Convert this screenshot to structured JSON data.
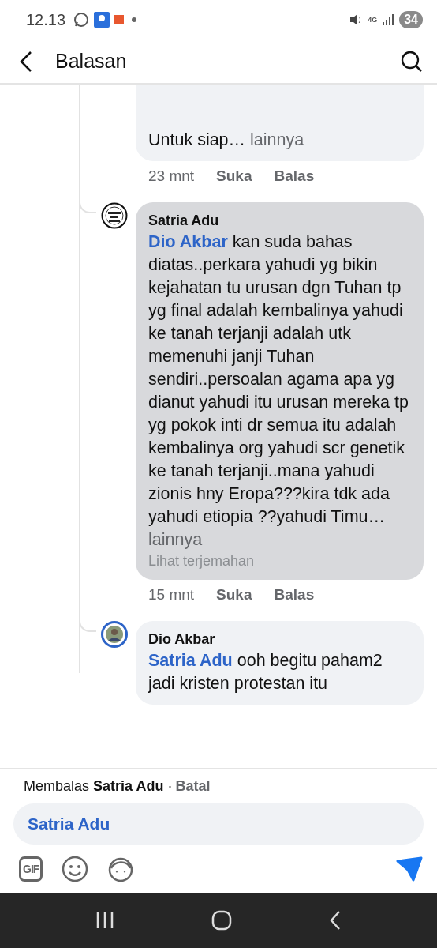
{
  "status_bar": {
    "time": "12.13",
    "network": "4G",
    "battery": "34"
  },
  "header": {
    "title": "Balasan"
  },
  "comments": [
    {
      "text": "Untuk siap…",
      "more": "lainnya",
      "time": "23 mnt",
      "actions": [
        "Suka",
        "Balas"
      ]
    },
    {
      "avatar": {
        "kind": "logo"
      },
      "author": "Satria Adu",
      "mention": "Dio Akbar",
      "text": "kan suda bahas diatas..perkara yahudi yg bikin kejahatan tu urusan dgn Tuhan tp yg final adalah kembalinya yahudi ke tanah terjanji adalah utk memenuhi janji Tuhan sendiri..persoalan agama apa yg dianut yahudi itu urusan mereka tp yg pokok inti dr semua itu adalah kembalinya org yahudi scr genetik ke tanah terjanji..mana yahudi zionis hny Eropa???kira tdk ada yahudi etiopia ??yahudi Timu…",
      "more": "lainnya",
      "translate": "Lihat terjemahan",
      "time": "15 mnt",
      "actions": [
        "Suka",
        "Balas"
      ]
    },
    {
      "avatar": {
        "kind": "photo"
      },
      "author": "Dio Akbar",
      "mention": "Satria Adu",
      "text": "ooh begitu paham2 jadi kristen protestan itu"
    }
  ],
  "composer": {
    "replying_to": "Membalas **Satria Adu** ·",
    "cancel": "Batal",
    "value": "Satria Adu",
    "gif": "GIF"
  }
}
